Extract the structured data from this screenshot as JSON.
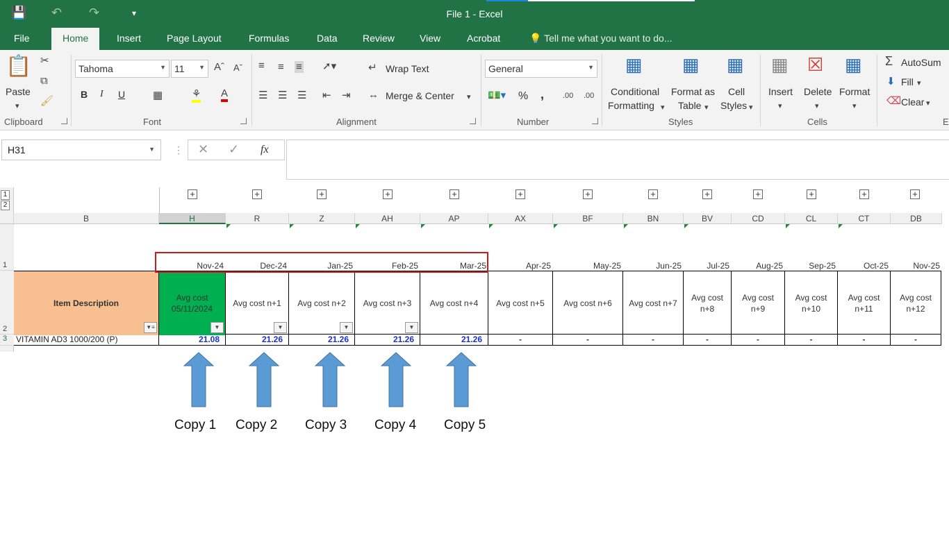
{
  "title": "File 1 - Excel",
  "tabs": [
    "File",
    "Home",
    "Insert",
    "Page Layout",
    "Formulas",
    "Data",
    "Review",
    "View",
    "Acrobat"
  ],
  "tell_me": "Tell me what you want to do...",
  "ribbon": {
    "clipboard": {
      "paste": "Paste",
      "label": "Clipboard"
    },
    "font": {
      "name": "Tahoma",
      "size": "11",
      "bold": "B",
      "italic": "I",
      "underline": "U",
      "label": "Font"
    },
    "alignment": {
      "wrap": "Wrap Text",
      "merge": "Merge & Center",
      "label": "Alignment"
    },
    "number": {
      "format": "General",
      "percent": "%",
      "comma": ",",
      "inc_dec": ".00",
      "label": "Number"
    },
    "styles": {
      "conditional": "Conditional",
      "conditional2": "Formatting",
      "format_as": "Format as",
      "format_as2": "Table",
      "cell": "Cell",
      "cell2": "Styles",
      "label": "Styles"
    },
    "cells": {
      "insert": "Insert",
      "delete": "Delete",
      "format": "Format",
      "label": "Cells"
    },
    "editing": {
      "autosum": "AutoSum",
      "fill": "Fill",
      "clear": "Clear",
      "label": "E"
    }
  },
  "name_box": "H31",
  "fx": "fx",
  "outline_levels": [
    "1",
    "2"
  ],
  "columns": [
    "B",
    "H",
    "R",
    "Z",
    "AH",
    "AP",
    "AX",
    "BF",
    "BN",
    "BV",
    "CD",
    "CL",
    "CT",
    "DB"
  ],
  "row_numbers": [
    "1",
    "2",
    "3"
  ],
  "dates": [
    "Nov-24",
    "Dec-24",
    "Jan-25",
    "Feb-25",
    "Mar-25",
    "Apr-25",
    "May-25",
    "Jun-25",
    "Jul-25",
    "Aug-25",
    "Sep-25",
    "Oct-25",
    "Nov-25"
  ],
  "header_cells": {
    "item": "Item Description",
    "first_line1": "Avg cost",
    "first_line2": "05/11/2024",
    "others": [
      "Avg cost n+1",
      "Avg cost n+2",
      "Avg cost n+3",
      "Avg cost n+4",
      "Avg cost n+5",
      "Avg cost n+6",
      "Avg cost n+7"
    ],
    "wrapped": [
      [
        "Avg cost",
        "n+8"
      ],
      [
        "Avg cost",
        "n+9"
      ],
      [
        "Avg cost",
        "n+10"
      ],
      [
        "Avg cost",
        "n+11"
      ],
      [
        "Avg cost",
        "n+12"
      ]
    ]
  },
  "data_row": {
    "item": "VITAMIN AD3 1000/200 (P)",
    "values": [
      "21.08",
      "21.26",
      "21.26",
      "21.26",
      "21.26"
    ],
    "dash": "-"
  },
  "copy_labels": [
    "Copy 1",
    "Copy 2",
    "Copy 3",
    "Copy 4",
    "Copy 5"
  ],
  "colors": {
    "excel_green": "#217346",
    "highlight_green": "#00b050",
    "item_header_fill": "#f8c090",
    "arrow_blue": "#5b9bd5",
    "red_box": "#d01818"
  }
}
